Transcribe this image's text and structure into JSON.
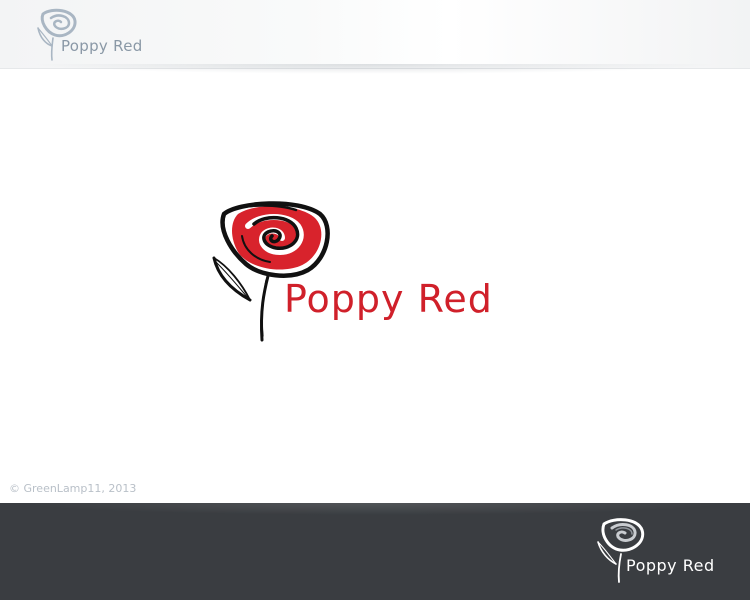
{
  "brand": {
    "name": "Poppy Red"
  },
  "copyright": {
    "symbol": "©",
    "text": "GreenLamp11, 2013"
  },
  "colors": {
    "brand_red": "#d0202a",
    "dark_band": "#3a3d41",
    "light_logo_text": "#8a98a6",
    "copyright_text": "#b9c0c8"
  },
  "icons": {
    "flower": "poppy-flower-icon",
    "copyright": "copyright-icon"
  }
}
